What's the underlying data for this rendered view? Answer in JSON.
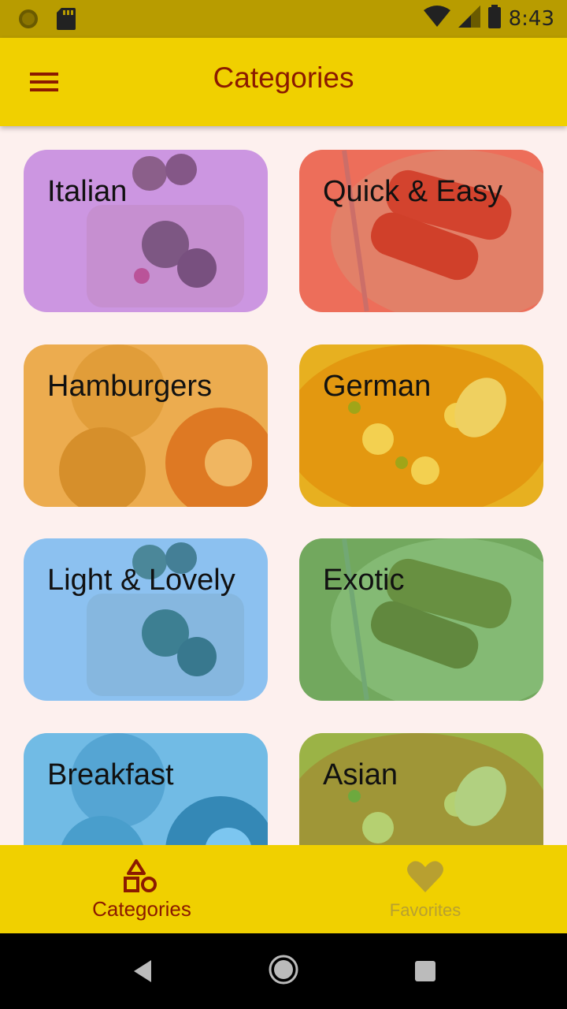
{
  "status_bar": {
    "time": "8:43",
    "icons": [
      "sun-icon",
      "sd-card-icon",
      "wifi-icon",
      "signal-icon",
      "battery-icon"
    ]
  },
  "app_bar": {
    "title": "Categories",
    "menu_icon": "menu-icon"
  },
  "categories": [
    {
      "label": "Italian",
      "color": "#b455d6"
    },
    {
      "label": "Quick & Easy",
      "color": "#f0453a"
    },
    {
      "label": "Hamburgers",
      "color": "#f59a1a"
    },
    {
      "label": "German",
      "color": "#f5c000"
    },
    {
      "label": "Light & Lovely",
      "color": "#3f9ff0"
    },
    {
      "label": "Exotic",
      "color": "#4caf50"
    },
    {
      "label": "Breakfast",
      "color": "#2aa9f0"
    },
    {
      "label": "Asian",
      "color": "#8bc34a"
    }
  ],
  "bottom_nav": {
    "items": [
      {
        "label": "Categories",
        "icon": "shapes-icon",
        "active": true
      },
      {
        "label": "Favorites",
        "icon": "heart-icon",
        "active": false
      }
    ]
  },
  "system_nav": [
    "back-icon",
    "home-icon",
    "recents-icon"
  ],
  "colors": {
    "app_bar": "#f0d000",
    "status_bar": "#b89c00",
    "accent": "#8b1a00",
    "background": "#fdf0ee"
  }
}
